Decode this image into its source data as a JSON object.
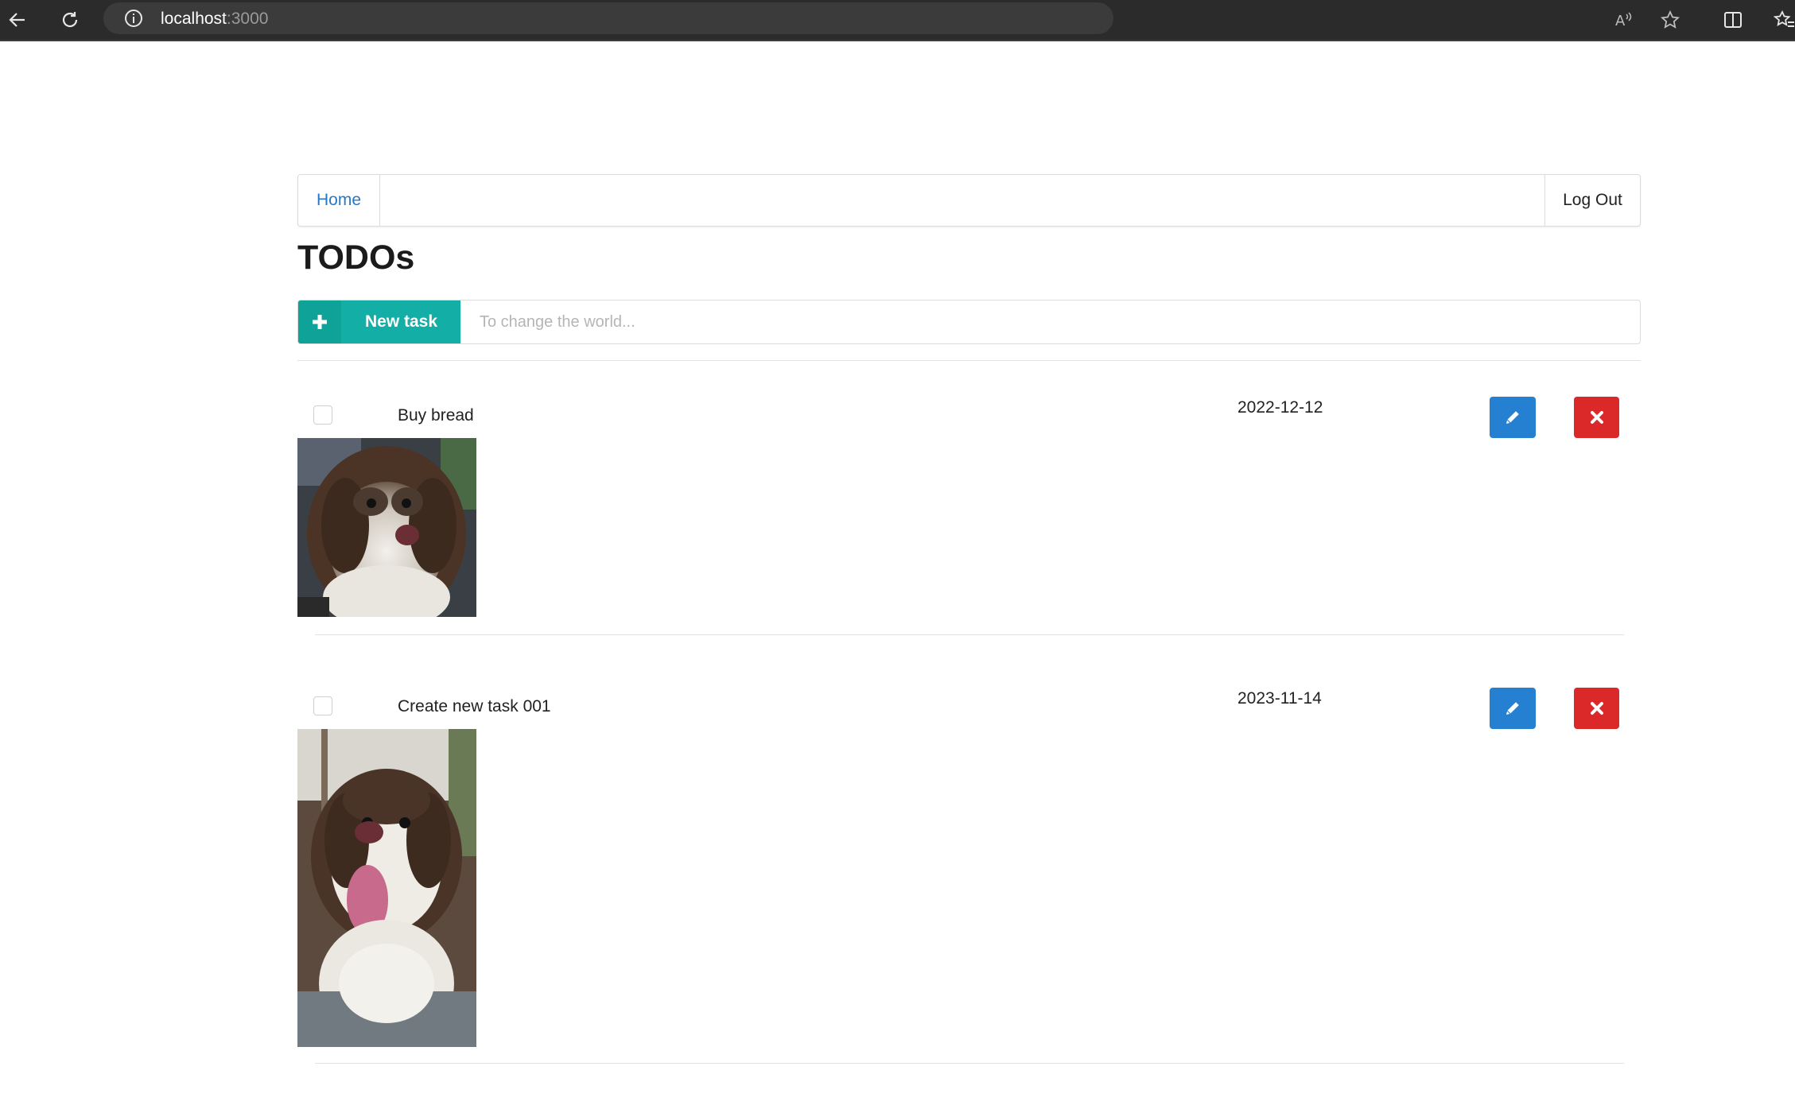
{
  "browser": {
    "url_host": "localhost",
    "url_port": ":3000"
  },
  "nav": {
    "home_label": "Home",
    "logout_label": "Log Out"
  },
  "page": {
    "title": "TODOs"
  },
  "new_task": {
    "button_label": "New task",
    "placeholder": "To change the world..."
  },
  "todos": [
    {
      "title": "Buy bread",
      "date": "2022-12-12",
      "completed": false
    },
    {
      "title": "Create new task 001",
      "date": "2023-11-14",
      "completed": false
    }
  ],
  "colors": {
    "accent_teal": "#13afa6",
    "edit_blue": "#2680d2",
    "delete_red": "#db2828",
    "link_blue": "#2678c8"
  }
}
